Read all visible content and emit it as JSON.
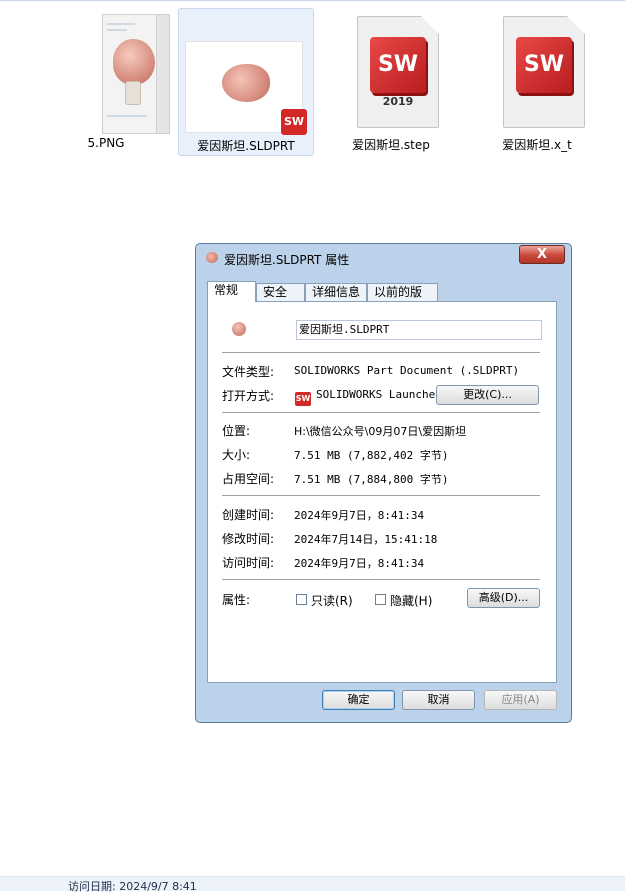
{
  "files": [
    {
      "label": "5.PNG"
    },
    {
      "label": "爱因斯坦.SLDPRT"
    },
    {
      "label": "爱因斯坦.step",
      "badge": "SW",
      "year": "2019"
    },
    {
      "label": "爱因斯坦.x_t",
      "badge": "SW"
    }
  ],
  "dialog": {
    "title": "爱因斯坦.SLDPRT 属性",
    "close": "X",
    "tabs": [
      "常规",
      "安全",
      "详细信息",
      "以前的版本"
    ],
    "name_value": "爱因斯坦.SLDPRT",
    "type_label": "文件类型:",
    "type_value": "SOLIDWORKS Part Document (.SLDPRT)",
    "open_label": "打开方式:",
    "open_value": "SOLIDWORKS Launcher",
    "change_button": "更改(C)...",
    "location_label": "位置:",
    "location_value": "H:\\微信公众号\\09月07日\\爱因斯坦",
    "size_label": "大小:",
    "size_value": "7.51 MB (7,882,402 字节)",
    "disk_label": "占用空间:",
    "disk_value": "7.51 MB (7,884,800 字节)",
    "created_label": "创建时间:",
    "created_value": "2024年9月7日，8:41:34",
    "modified_label": "修改时间:",
    "modified_value": "2024年7月14日，15:41:18",
    "accessed_label": "访问时间:",
    "accessed_value": "2024年9月7日，8:41:34",
    "attr_label": "属性:",
    "readonly_label": "只读(R)",
    "hidden_label": "隐藏(H)",
    "advanced_button": "高级(D)...",
    "ok_button": "确定",
    "cancel_button": "取消",
    "apply_button": "应用(A)"
  },
  "status_bar": "访问日期: 2024/9/7 8:41",
  "colors": {
    "accent": "#d22828",
    "dialog_frame": "#bcd2ea"
  }
}
